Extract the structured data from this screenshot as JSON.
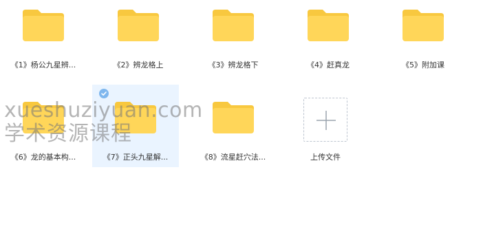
{
  "files": [
    {
      "label": "《1》杨公九星辨...",
      "icon": "folder-icon"
    },
    {
      "label": "《2》辨龙格上",
      "icon": "folder-icon"
    },
    {
      "label": "《3》辨龙格下",
      "icon": "folder-icon"
    },
    {
      "label": "《4》赶真龙",
      "icon": "folder-icon"
    },
    {
      "label": "《5》附加课",
      "icon": "folder-icon"
    },
    {
      "label": "《6》龙的基本构...",
      "icon": "folder-icon"
    },
    {
      "label": "《7》正头九星解...",
      "icon": "folder-icon",
      "selected": true
    },
    {
      "label": "《8》流星赶穴法...",
      "icon": "folder-icon"
    }
  ],
  "upload": {
    "label": "上传文件",
    "icon": "plus-icon"
  },
  "watermark": {
    "line1": "xueshuziyuan.com",
    "line2": "学术资源课程"
  },
  "colors": {
    "folder_body": "#ffd659",
    "folder_tab": "#f8c83f",
    "selection_bg": "#eaf4ff",
    "check_badge": "#7fb7ee"
  }
}
